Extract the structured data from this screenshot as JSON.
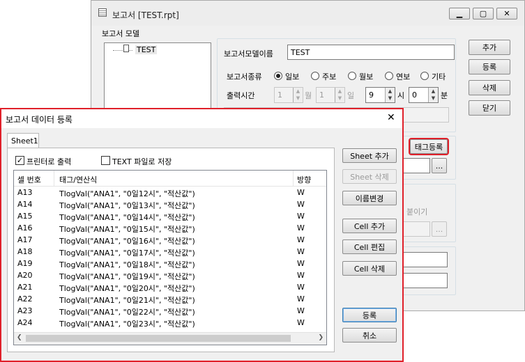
{
  "back_window": {
    "title": "보고서 [TEST.rpt]",
    "group_title": "보고서 모델",
    "tree_item": "TEST",
    "model_name_label": "보고서모델이름",
    "model_name_value": "TEST",
    "type_label": "보고서종류",
    "types": [
      "일보",
      "주보",
      "월보",
      "연보",
      "기타"
    ],
    "output_time_label": "출력시간",
    "month_value": "1",
    "month_unit": "월",
    "day_value": "1",
    "day_unit": "일",
    "hour_value": "9",
    "hour_unit": "시",
    "minute_value": "0",
    "minute_unit": "분",
    "tag_register": "태그등록",
    "browse": "...",
    "partial_label": "붙이기",
    "buttons": {
      "add": "추가",
      "register": "등록",
      "delete": "삭제",
      "close": "닫기"
    }
  },
  "dialog": {
    "title": "보고서 데이터 등록",
    "close": "✕",
    "tab": "Sheet1",
    "print_label": "프린터로 출력",
    "text_save_label": "TEXT 파일로 저장",
    "columns": [
      "셀 번호",
      "태그/연산식",
      "방향"
    ],
    "rows": [
      {
        "cell": "A13",
        "expr": "TlogVal(\"ANA1\", \"0일12시\", \"적산값\")",
        "dir": "W"
      },
      {
        "cell": "A14",
        "expr": "TlogVal(\"ANA1\", \"0일13시\", \"적산값\")",
        "dir": "W"
      },
      {
        "cell": "A15",
        "expr": "TlogVal(\"ANA1\", \"0일14시\", \"적산값\")",
        "dir": "W"
      },
      {
        "cell": "A16",
        "expr": "TlogVal(\"ANA1\", \"0일15시\", \"적산값\")",
        "dir": "W"
      },
      {
        "cell": "A17",
        "expr": "TlogVal(\"ANA1\", \"0일16시\", \"적산값\")",
        "dir": "W"
      },
      {
        "cell": "A18",
        "expr": "TlogVal(\"ANA1\", \"0일17시\", \"적산값\")",
        "dir": "W"
      },
      {
        "cell": "A19",
        "expr": "TlogVal(\"ANA1\", \"0일18시\", \"적산값\")",
        "dir": "W"
      },
      {
        "cell": "A20",
        "expr": "TlogVal(\"ANA1\", \"0일19시\", \"적산값\")",
        "dir": "W"
      },
      {
        "cell": "A21",
        "expr": "TlogVal(\"ANA1\", \"0일20시\", \"적산값\")",
        "dir": "W"
      },
      {
        "cell": "A22",
        "expr": "TlogVal(\"ANA1\", \"0일21시\", \"적산값\")",
        "dir": "W"
      },
      {
        "cell": "A23",
        "expr": "TlogVal(\"ANA1\", \"0일22시\", \"적산값\")",
        "dir": "W"
      },
      {
        "cell": "A24",
        "expr": "TlogVal(\"ANA1\", \"0일23시\", \"적산값\")",
        "dir": "W"
      }
    ],
    "buttons": {
      "sheet_add": "Sheet 추가",
      "sheet_delete": "Sheet 삭제",
      "rename": "이름변경",
      "cell_add": "Cell 추가",
      "cell_edit": "Cell 편집",
      "cell_delete": "Cell 삭제",
      "register": "등록",
      "cancel": "취소"
    }
  },
  "colors": {
    "highlight": "#e0202a",
    "window_frame": "#a9a9a9"
  }
}
